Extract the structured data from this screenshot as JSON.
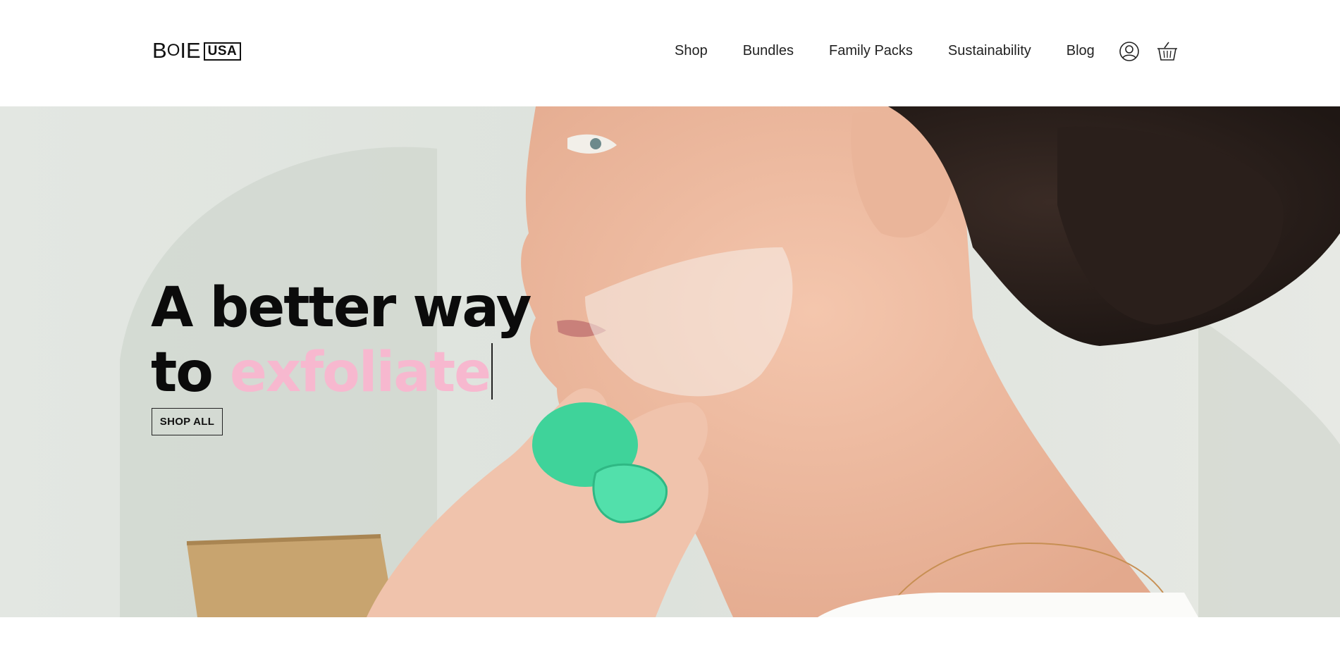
{
  "brand": {
    "logo_text_b": "B",
    "logo_text_o": "O",
    "logo_text_ie": "IE",
    "logo_region": "USA"
  },
  "nav": {
    "items": [
      {
        "label": "Shop"
      },
      {
        "label": "Bundles"
      },
      {
        "label": "Family Packs"
      },
      {
        "label": "Sustainability"
      },
      {
        "label": "Blog"
      }
    ],
    "account_icon": "account-icon",
    "cart_icon": "cart-icon"
  },
  "hero": {
    "headline_line1": "A better way",
    "headline_to": "to",
    "headline_accent": "exfoliate",
    "cta_label": "SHOP ALL",
    "accent_color": "#f7b8cf"
  }
}
